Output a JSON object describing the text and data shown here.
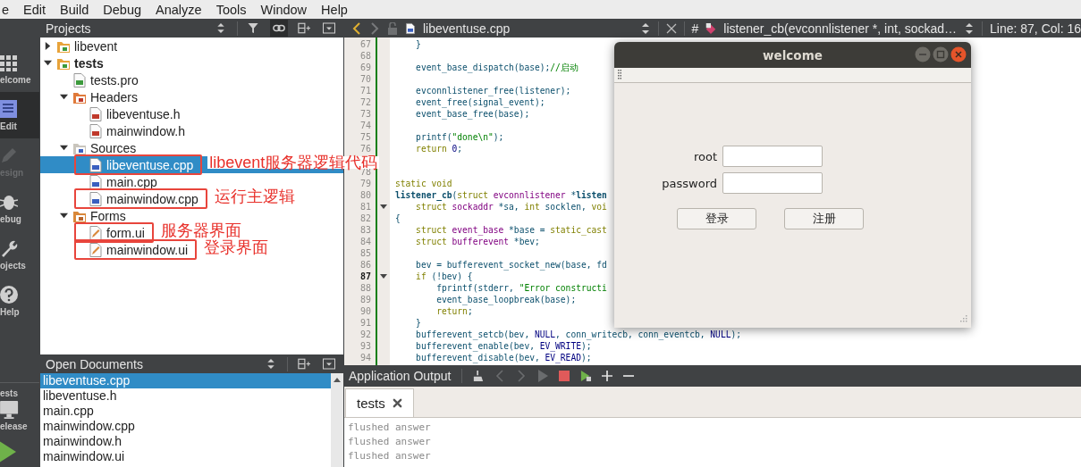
{
  "menu": [
    "e",
    "Edit",
    "Build",
    "Debug",
    "Analyze",
    "Tools",
    "Window",
    "Help"
  ],
  "mode_bar": [
    {
      "label": "elcome",
      "kind": "welcome",
      "selected": false,
      "disabled": false
    },
    {
      "label": "Edit",
      "kind": "edit",
      "selected": true,
      "disabled": false
    },
    {
      "label": "esign",
      "kind": "design",
      "selected": false,
      "disabled": true
    },
    {
      "label": "ebug",
      "kind": "debug",
      "selected": false,
      "disabled": false
    },
    {
      "label": "ojects",
      "kind": "projects",
      "selected": false,
      "disabled": false
    },
    {
      "label": "Help",
      "kind": "help",
      "selected": false,
      "disabled": false
    }
  ],
  "kit": {
    "project": "ests",
    "build": "elease"
  },
  "projects_panel": {
    "title": "Projects",
    "tree": [
      {
        "label": "libevent",
        "kind": "project",
        "active": false,
        "expanded": false,
        "selected": false,
        "boxed": false
      },
      {
        "label": "tests",
        "kind": "project",
        "active": true,
        "expanded": true,
        "selected": false,
        "boxed": false,
        "children": [
          {
            "label": "tests.pro",
            "kind": "pro",
            "selected": false,
            "boxed": false
          },
          {
            "label": "Headers",
            "kind": "header_folder",
            "expanded": true,
            "selected": false,
            "boxed": false,
            "children": [
              {
                "label": "libeventuse.h",
                "kind": "header",
                "selected": false,
                "boxed": false
              },
              {
                "label": "mainwindow.h",
                "kind": "header",
                "selected": false,
                "boxed": false
              }
            ]
          },
          {
            "label": "Sources",
            "kind": "source_folder",
            "expanded": true,
            "selected": false,
            "boxed": false,
            "children": [
              {
                "label": "libeventuse.cpp",
                "kind": "source",
                "selected": true,
                "boxed": true,
                "note": "libevent服务器逻辑代码"
              },
              {
                "label": "main.cpp",
                "kind": "source",
                "selected": false,
                "boxed": false
              },
              {
                "label": "mainwindow.cpp",
                "kind": "source",
                "selected": false,
                "boxed": true,
                "note": "运行主逻辑"
              }
            ]
          },
          {
            "label": "Forms",
            "kind": "form_folder",
            "expanded": true,
            "selected": false,
            "boxed": false,
            "children": [
              {
                "label": "form.ui",
                "kind": "form",
                "selected": false,
                "boxed": true,
                "note": "服务器界面"
              },
              {
                "label": "mainwindow.ui",
                "kind": "form",
                "selected": false,
                "boxed": true,
                "note": "登录界面"
              }
            ]
          }
        ]
      }
    ]
  },
  "open_documents": {
    "title": "Open Documents",
    "items": [
      {
        "label": "libeventuse.cpp",
        "selected": true
      },
      {
        "label": "libeventuse.h",
        "selected": false
      },
      {
        "label": "main.cpp",
        "selected": false
      },
      {
        "label": "mainwindow.cpp",
        "selected": false
      },
      {
        "label": "mainwindow.h",
        "selected": false
      },
      {
        "label": "mainwindow.ui",
        "selected": false
      }
    ]
  },
  "editor": {
    "file": "libeventuse.cpp",
    "hash": "#",
    "symbol": "listener_cb(evconnlistener *, int, sockad…",
    "position": "Line: 87, Col: 16",
    "lines": [
      {
        "number": "67",
        "fold": false,
        "current": false,
        "tokens": [
          {
            "text": "    }",
            "kind": "plain"
          }
        ]
      },
      {
        "number": "68",
        "fold": false,
        "current": false
      },
      {
        "number": "69",
        "fold": false,
        "current": false,
        "tokens": [
          {
            "text": "    event_base_dispatch(base);",
            "kind": "plain"
          },
          {
            "text": "//启动",
            "kind": "comment"
          }
        ]
      },
      {
        "number": "70",
        "fold": false,
        "current": false
      },
      {
        "number": "71",
        "fold": false,
        "current": false,
        "tokens": [
          {
            "text": "    evconnlistener_free(listener);",
            "kind": "plain"
          }
        ]
      },
      {
        "number": "72",
        "fold": false,
        "current": false,
        "tokens": [
          {
            "text": "    event_free(signal_event);",
            "kind": "plain"
          }
        ]
      },
      {
        "number": "73",
        "fold": false,
        "current": false,
        "tokens": [
          {
            "text": "    event_base_free(base);",
            "kind": "plain"
          }
        ]
      },
      {
        "number": "74",
        "fold": false,
        "current": false
      },
      {
        "number": "75",
        "fold": false,
        "current": false,
        "tokens": [
          {
            "text": "    printf(",
            "kind": "plain"
          },
          {
            "text": "\"done\\n\"",
            "kind": "string"
          },
          {
            "text": ");",
            "kind": "plain"
          }
        ]
      },
      {
        "number": "76",
        "fold": false,
        "current": false,
        "tokens": [
          {
            "text": "    return ",
            "kind": "keyword"
          },
          {
            "text": "0",
            "kind": "number"
          },
          {
            "text": ";",
            "kind": "plain"
          }
        ]
      },
      {
        "number": "78",
        "fold": false,
        "current": false
      },
      {
        "number": "79",
        "fold": false,
        "current": false,
        "tokens": [
          {
            "text": "static void",
            "kind": "keyword"
          }
        ]
      },
      {
        "number": "80",
        "fold": false,
        "current": false,
        "tokens": [
          {
            "text": "listener_cb",
            "kind": "decl"
          },
          {
            "text": "(",
            "kind": "plain"
          },
          {
            "text": "struct ",
            "kind": "keyword"
          },
          {
            "text": "evconnlistener",
            "kind": "type"
          },
          {
            "text": " *",
            "kind": "plain"
          },
          {
            "text": "listen",
            "kind": "decl"
          }
        ]
      },
      {
        "number": "81",
        "fold": true,
        "current": false,
        "tokens": [
          {
            "text": "    struct ",
            "kind": "keyword"
          },
          {
            "text": "sockaddr",
            "kind": "type"
          },
          {
            "text": " *sa, ",
            "kind": "plain"
          },
          {
            "text": "int",
            "kind": "keyword"
          },
          {
            "text": " socklen, ",
            "kind": "plain"
          },
          {
            "text": "voi",
            "kind": "keyword"
          }
        ]
      },
      {
        "number": "82",
        "fold": false,
        "current": false,
        "tokens": [
          {
            "text": "{",
            "kind": "plain"
          }
        ]
      },
      {
        "number": "83",
        "fold": false,
        "current": false,
        "tokens": [
          {
            "text": "    struct ",
            "kind": "keyword"
          },
          {
            "text": "event_base",
            "kind": "type"
          },
          {
            "text": " *base = ",
            "kind": "plain"
          },
          {
            "text": "static_cast",
            "kind": "keyword"
          }
        ]
      },
      {
        "number": "84",
        "fold": false,
        "current": false,
        "tokens": [
          {
            "text": "    struct ",
            "kind": "keyword"
          },
          {
            "text": "bufferevent",
            "kind": "type"
          },
          {
            "text": " *bev;",
            "kind": "plain"
          }
        ]
      },
      {
        "number": "85",
        "fold": false,
        "current": false
      },
      {
        "number": "86",
        "fold": false,
        "current": false,
        "tokens": [
          {
            "text": "    bev = bufferevent_socket_new(base, fd",
            "kind": "plain"
          }
        ]
      },
      {
        "number": "87",
        "fold": true,
        "current": true,
        "tokens": [
          {
            "text": "    if",
            "kind": "keyword"
          },
          {
            "text": " (!bev) {",
            "kind": "plain"
          }
        ]
      },
      {
        "number": "88",
        "fold": false,
        "current": false,
        "tokens": [
          {
            "text": "        fprintf(stderr, ",
            "kind": "plain"
          },
          {
            "text": "\"Error constructi",
            "kind": "string"
          }
        ]
      },
      {
        "number": "89",
        "fold": false,
        "current": false,
        "tokens": [
          {
            "text": "        event_base_loopbreak(base);",
            "kind": "plain"
          }
        ]
      },
      {
        "number": "90",
        "fold": false,
        "current": false,
        "tokens": [
          {
            "text": "        return",
            "kind": "keyword"
          },
          {
            "text": ";",
            "kind": "plain"
          }
        ]
      },
      {
        "number": "91",
        "fold": false,
        "current": false,
        "tokens": [
          {
            "text": "    }",
            "kind": "plain"
          }
        ]
      },
      {
        "number": "92",
        "fold": false,
        "current": false,
        "tokens": [
          {
            "text": "    bufferevent_setcb(bev, ",
            "kind": "plain"
          },
          {
            "text": "NULL",
            "kind": "number"
          },
          {
            "text": ", conn_writecb, conn_eventcb, ",
            "kind": "plain"
          },
          {
            "text": "NULL",
            "kind": "number"
          },
          {
            "text": ");",
            "kind": "plain"
          }
        ]
      },
      {
        "number": "93",
        "fold": false,
        "current": false,
        "tokens": [
          {
            "text": "    bufferevent_enable(bev, ",
            "kind": "plain"
          },
          {
            "text": "EV_WRITE",
            "kind": "number"
          },
          {
            "text": ");",
            "kind": "plain"
          }
        ]
      },
      {
        "number": "94",
        "fold": false,
        "current": false,
        "tokens": [
          {
            "text": "    bufferevent_disable(bev, ",
            "kind": "plain"
          },
          {
            "text": "EV_READ",
            "kind": "number"
          },
          {
            "text": ");",
            "kind": "plain"
          }
        ]
      }
    ]
  },
  "dialog": {
    "title": "welcome",
    "fields": [
      {
        "label": "root"
      },
      {
        "label": "password"
      }
    ],
    "buttons": [
      "登录",
      "注册"
    ]
  },
  "output": {
    "title": "Application Output",
    "tabs": [
      {
        "label": "tests",
        "selected": true
      }
    ],
    "lines": [
      "flushed answer",
      "flushed answer",
      "flushed answer"
    ]
  }
}
